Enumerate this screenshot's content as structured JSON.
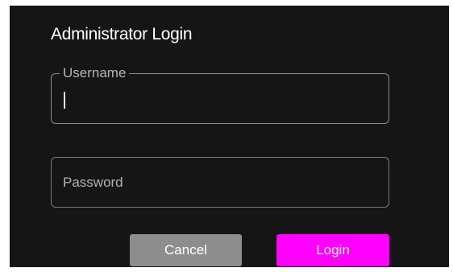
{
  "dialog": {
    "title": "Administrator Login"
  },
  "username_field": {
    "label": "Username",
    "value": ""
  },
  "password_field": {
    "placeholder": "Password",
    "value": ""
  },
  "buttons": {
    "cancel_label": "Cancel",
    "login_label": "Login"
  },
  "colors": {
    "background": "#151515",
    "login_accent": "#ff00ff",
    "cancel_gray": "#8d8d8d",
    "field_border": "#7a7a7a",
    "label_text": "#b5b5b5"
  }
}
